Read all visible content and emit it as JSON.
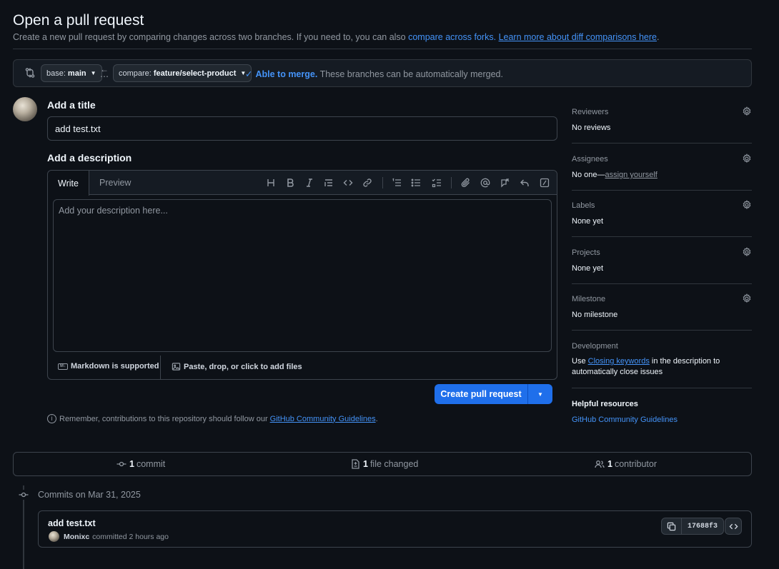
{
  "header": {
    "title": "Open a pull request",
    "subtitle_text": "Create a new pull request by comparing changes across two branches. If you need to, you can also",
    "compare_forks_link": "compare across forks.",
    "learn_more_link": "Learn more about diff comparisons here",
    "learn_more_suffix": "."
  },
  "branches": {
    "base_label": "base:",
    "base_value": "main",
    "compare_label": "compare:",
    "compare_value": "feature/select-product",
    "merge_ok": "Able to merge.",
    "merge_text": "These branches can be automatically merged."
  },
  "form": {
    "title_label": "Add a title",
    "title_value": "add test.txt",
    "description_label": "Add a description",
    "tab_write": "Write",
    "tab_preview": "Preview",
    "description_placeholder": "Add your description here...",
    "markdown_note": "Markdown is supported",
    "attach_note": "Paste, drop, or click to add files",
    "create_button": "Create pull request",
    "remember_text": "Remember, contributions to this repository should follow our",
    "guidelines_link": "GitHub Community Guidelines",
    "remember_suffix": "."
  },
  "sidebar": {
    "reviewers": {
      "heading": "Reviewers",
      "value": "No reviews"
    },
    "assignees": {
      "heading": "Assignees",
      "value": "No one—",
      "link": "assign yourself"
    },
    "labels": {
      "heading": "Labels",
      "value": "None yet"
    },
    "projects": {
      "heading": "Projects",
      "value": "None yet"
    },
    "milestone": {
      "heading": "Milestone",
      "value": "No milestone"
    },
    "development": {
      "heading": "Development",
      "prefix": "Use",
      "link": "Closing keywords",
      "suffix": "in the description to automatically close issues"
    },
    "helpful": {
      "heading": "Helpful resources",
      "link": "GitHub Community Guidelines"
    }
  },
  "stats": {
    "commits_count": "1",
    "commits_label": "commit",
    "files_count": "1",
    "files_label": "file changed",
    "contributors_count": "1",
    "contributors_label": "contributor"
  },
  "commits": {
    "date_heading": "Commits on Mar 31, 2025",
    "items": [
      {
        "title": "add test.txt",
        "author": "Monixc",
        "meta": "committed 2 hours ago",
        "sha": "17688f3"
      }
    ]
  },
  "icons": [
    "git-compare-icon",
    "arrow-left-icon",
    "check-icon",
    "heading-icon",
    "bold-icon",
    "italic-icon",
    "quote-icon",
    "code-icon",
    "link-icon",
    "ordered-list-icon",
    "unordered-list-icon",
    "task-list-icon",
    "paperclip-icon",
    "mention-icon",
    "cross-reference-icon",
    "reply-icon",
    "slash-command-icon",
    "markdown-icon",
    "image-icon",
    "info-icon",
    "gear-icon",
    "commit-icon",
    "file-diff-icon",
    "people-icon",
    "copy-icon",
    "code-browse-icon"
  ],
  "colors": {
    "accent": "#4493f8",
    "primary_button": "#1f6feb",
    "background": "#0d1117",
    "border": "#3d444d"
  }
}
